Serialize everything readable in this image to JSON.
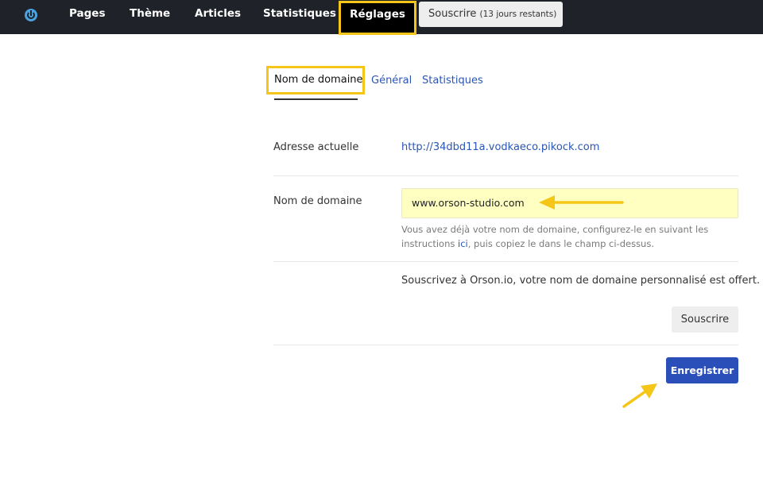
{
  "topbar": {
    "items": [
      {
        "label": "Pages"
      },
      {
        "label": "Thème"
      },
      {
        "label": "Articles"
      },
      {
        "label": "Statistiques"
      },
      {
        "label": "Réglages",
        "active": true
      }
    ],
    "subscribe": {
      "label": "Souscrire",
      "remaining": "(13 jours restants)"
    }
  },
  "tabs": [
    {
      "label": "Nom de domaine",
      "active": true
    },
    {
      "label": "Général"
    },
    {
      "label": "Statistiques"
    }
  ],
  "settings": {
    "current_address_label": "Adresse actuelle",
    "current_address_value": "http://34dbd11a.vodkaeco.pikock.com",
    "domain_label": "Nom de domaine",
    "domain_value": "www.orson-studio.com",
    "help_before": "Vous avez déjà votre nom de domaine, configurez-le en suivant les instructions ",
    "help_link": "ici",
    "help_after": ", puis copiez le dans le champ ci-dessus.",
    "offer_text": "Souscrivez à Orson.io, votre nom de domaine personnalisé est offert.",
    "subscribe_button": "Souscrire",
    "save_button": "Enregistrer"
  },
  "colors": {
    "topbar_bg": "#1f2229",
    "highlight": "#f5c518",
    "link": "#2a55b4",
    "primary_button": "#2a4fb8",
    "input_bg": "#ffffc2"
  }
}
